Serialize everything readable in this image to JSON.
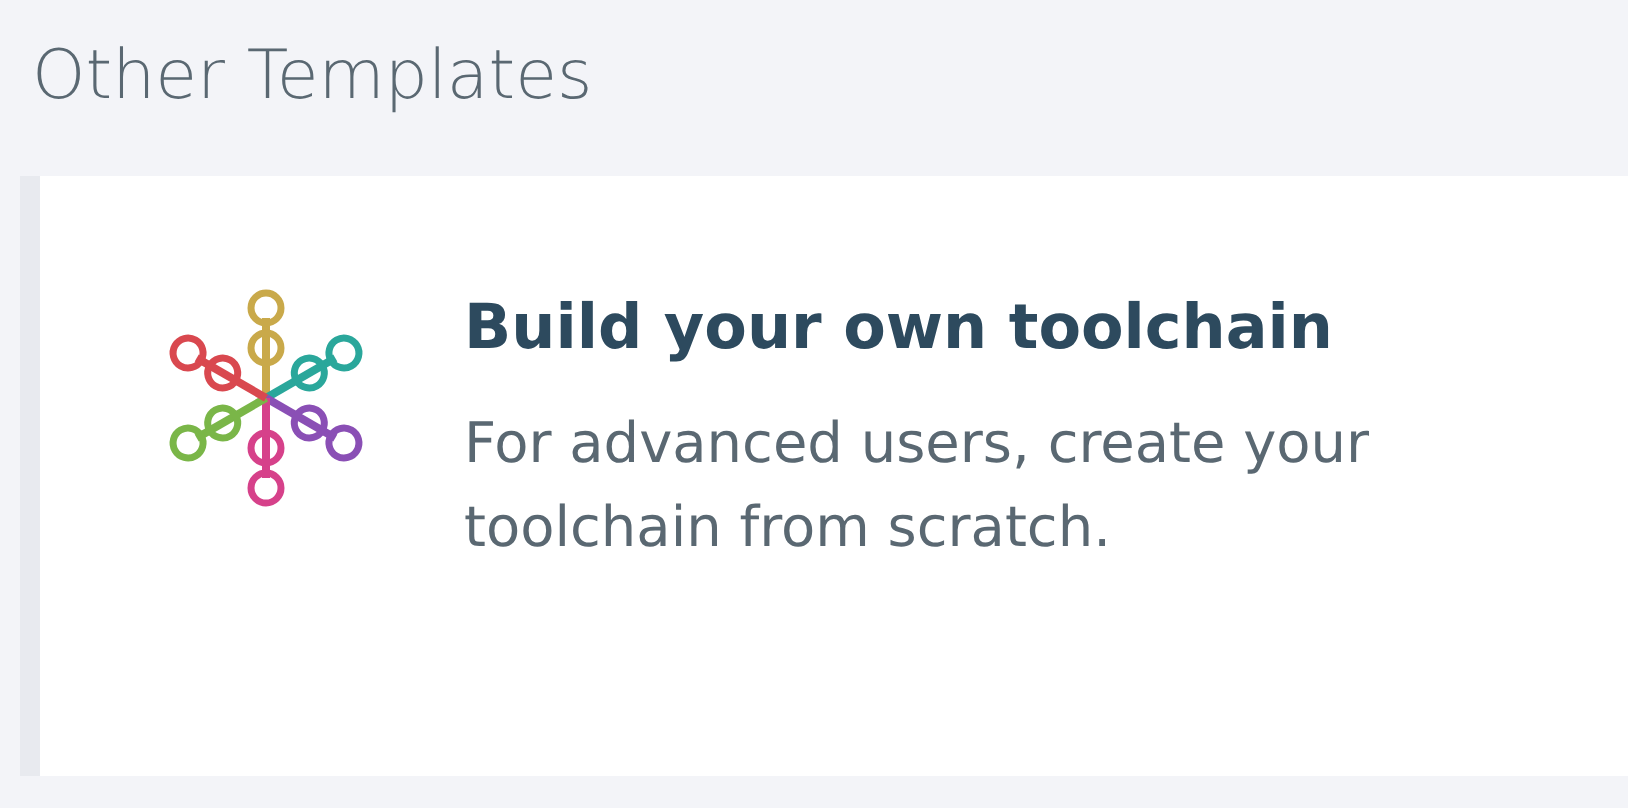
{
  "section": {
    "title": "Other Templates"
  },
  "templates": [
    {
      "title": "Build your own toolchain",
      "description": "For advanced users, create your toolchain from scratch."
    }
  ]
}
